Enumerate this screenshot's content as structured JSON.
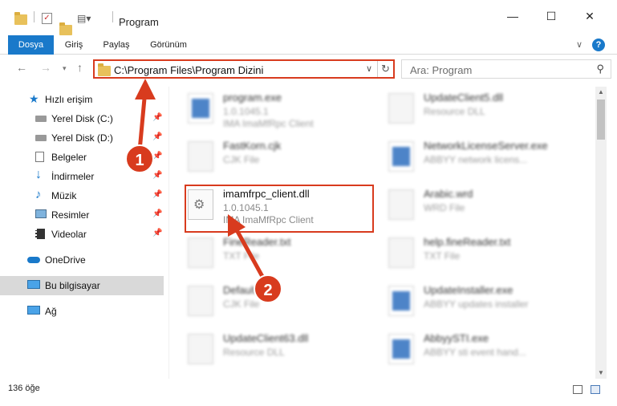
{
  "window": {
    "title": "Program",
    "minimize": "—",
    "maximize": "☐",
    "close": "✕"
  },
  "ribbon": {
    "tabs": [
      "Dosya",
      "Giriş",
      "Paylaş",
      "Görünüm"
    ]
  },
  "address": {
    "path": "C:\\Program Files\\Program Dizini",
    "search_placeholder": "Ara: Program"
  },
  "sidebar": {
    "items": [
      {
        "label": "Hızlı erişim"
      },
      {
        "label": "Yerel Disk (C:)"
      },
      {
        "label": "Yerel Disk (D:)"
      },
      {
        "label": "Belgeler"
      },
      {
        "label": "İndirmeler"
      },
      {
        "label": "Müzik"
      },
      {
        "label": "Resimler"
      },
      {
        "label": "Videolar"
      },
      {
        "label": "OneDrive"
      },
      {
        "label": "Bu bilgisayar"
      },
      {
        "label": "Ağ"
      }
    ]
  },
  "files": [
    {
      "name": "program.exe",
      "line2": "1.0.1045.1",
      "line3": "IMA ImaMfRpc Client"
    },
    {
      "name": "FastKorn.cjk",
      "line2": "CJK File",
      "line3": ""
    },
    {
      "name": "imamfrpc_client.dll",
      "line2": "1.0.1045.1",
      "line3": "IMA ImaMfRpc Client"
    },
    {
      "name": "FineReader.txt",
      "line2": "TXT File",
      "line3": ""
    },
    {
      "name": "Default.cjk",
      "line2": "CJK File",
      "line3": ""
    },
    {
      "name": "UpdateClient63.dll",
      "line2": "Resource DLL",
      "line3": ""
    },
    {
      "name": "UpdateClient5.dll",
      "line2": "Resource DLL",
      "line3": ""
    },
    {
      "name": "NetworkLicenseServer.exe",
      "line2": "ABBYY network licens...",
      "line3": ""
    },
    {
      "name": "Arabic.wrd",
      "line2": "WRD File",
      "line3": ""
    },
    {
      "name": "help.fineReader.txt",
      "line2": "TXT File",
      "line3": ""
    },
    {
      "name": "UpdateInstaller.exe",
      "line2": "ABBYY updates installer",
      "line3": ""
    },
    {
      "name": "AbbyySTI.exe",
      "line2": "ABBYY sti event hand...",
      "line3": ""
    }
  ],
  "status": {
    "count": "136 öğe"
  },
  "callouts": [
    "1",
    "2"
  ],
  "colors": {
    "accent": "#1979ca",
    "highlight": "#d83b1e"
  }
}
